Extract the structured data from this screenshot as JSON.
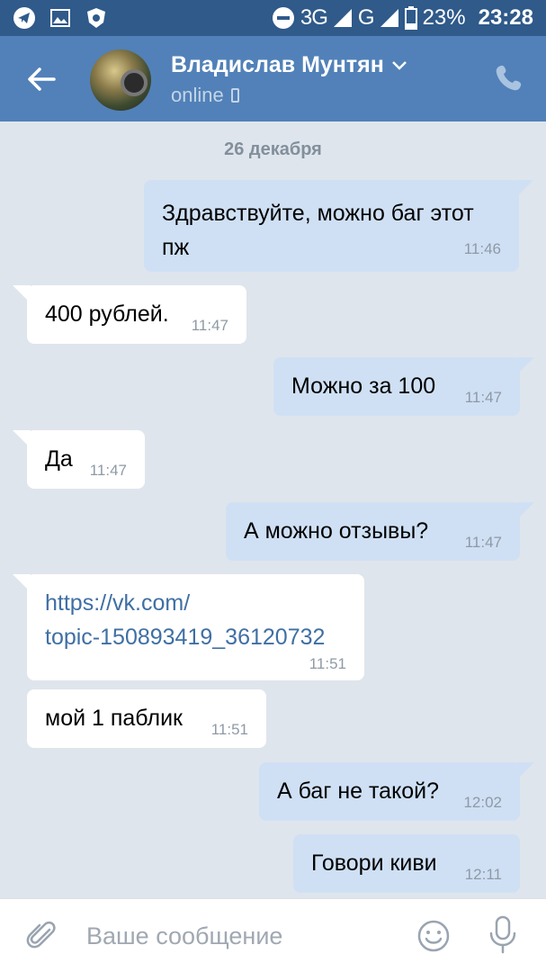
{
  "status_bar": {
    "network": "3G",
    "network_small": "3G",
    "network2": "G",
    "battery": "23%",
    "time": "23:28",
    "icons": [
      "telegram-icon",
      "gallery-icon",
      "shield-icon"
    ]
  },
  "header": {
    "contact_name": "Владислав Мунтян",
    "status": "online"
  },
  "date_separator": "26 декабря",
  "messages": [
    {
      "direction": "out",
      "line1": "Здравствуйте, можно баг этот",
      "line2": "пж",
      "time": "11:46"
    },
    {
      "direction": "in",
      "text": "400 рублей.",
      "time": "11:47"
    },
    {
      "direction": "out",
      "text": "Можно за 100",
      "time": "11:47"
    },
    {
      "direction": "in",
      "text": "Да",
      "time": "11:47"
    },
    {
      "direction": "out",
      "text": "А можно отзывы?",
      "time": "11:47"
    },
    {
      "direction": "in",
      "line1": "https://vk.com/",
      "line2": "topic-150893419_36120732",
      "time": "11:51"
    },
    {
      "direction": "in",
      "text": "мой 1 паблик",
      "time": "11:51"
    },
    {
      "direction": "out",
      "text": "А баг не такой?",
      "time": "12:02"
    },
    {
      "direction": "out",
      "text": "Говори киви",
      "time": "12:11"
    }
  ],
  "composer": {
    "placeholder": "Ваше сообщение"
  },
  "colors": {
    "statusbar": "#2f5a8a",
    "header": "#5181b8",
    "background": "#dfe5ec",
    "outgoing_bubble": "#cfe0f4",
    "incoming_bubble": "#ffffff",
    "link": "#3f6fa4"
  }
}
